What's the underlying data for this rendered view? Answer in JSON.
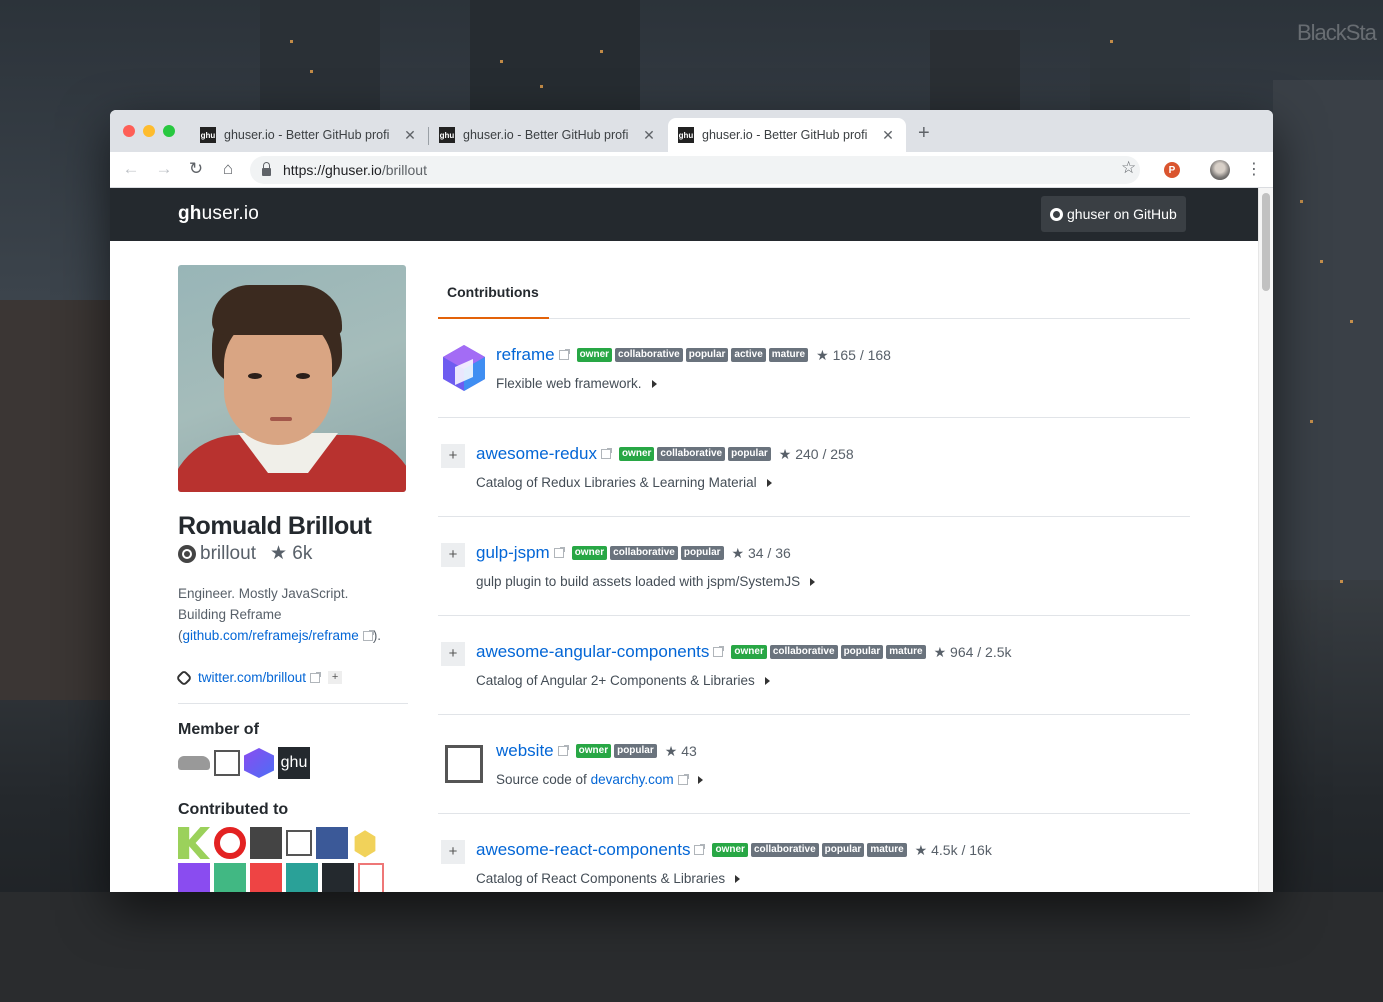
{
  "desktop": {
    "watermark": "BlackSta"
  },
  "browser": {
    "tabs": [
      {
        "favicon": "ghu",
        "title": "ghuser.io - Better GitHub profi",
        "close": "✕"
      },
      {
        "favicon": "ghu",
        "title": "ghuser.io - Better GitHub profi",
        "close": "✕"
      },
      {
        "favicon": "ghu",
        "title": "ghuser.io - Better GitHub profi",
        "close": "✕"
      }
    ],
    "new_tab": "+",
    "back": "←",
    "forward": "→",
    "reload": "↻",
    "home": "⌂",
    "url_host": "https://ghuser.io",
    "url_path": "/brillout",
    "bookmark_star": "☆",
    "extension": "P",
    "menu": "⋮"
  },
  "site": {
    "logo_bold": "gh",
    "logo_rest": "user.io",
    "github_button": "ghuser on GitHub"
  },
  "profile": {
    "name": "Romuald Brillout",
    "handle": "brillout",
    "stars": "★ 6k",
    "bio_line1": "Engineer. Mostly JavaScript.",
    "bio_line2": "Building Reframe",
    "bio_open": "(",
    "bio_link": "github.com/reframejs/reframe",
    "bio_close": ").",
    "twitter": "twitter.com/brillout",
    "twitter_plus": "+",
    "member_of_heading": "Member of",
    "member_ghu": "ghu",
    "contributed_heading": "Contributed to"
  },
  "main": {
    "tab_label": "Contributions",
    "repos": [
      {
        "name": "reframe",
        "badges": [
          "collaborative",
          "popular",
          "active",
          "mature"
        ],
        "owner": "owner",
        "stars": "★ 165 / 168",
        "desc": "Flexible web framework.",
        "desc_link": "",
        "plus": ""
      },
      {
        "name": "awesome-redux",
        "badges": [
          "collaborative",
          "popular"
        ],
        "owner": "owner",
        "stars": "★ 240 / 258",
        "desc": "Catalog of Redux Libraries & Learning Material",
        "desc_link": "",
        "plus": "+"
      },
      {
        "name": "gulp-jspm",
        "badges": [
          "collaborative",
          "popular"
        ],
        "owner": "owner",
        "stars": "★ 34 / 36",
        "desc": "gulp plugin to build assets loaded with jspm/SystemJS",
        "desc_link": "",
        "plus": "+"
      },
      {
        "name": "awesome-angular-components",
        "badges": [
          "collaborative",
          "popular",
          "mature"
        ],
        "owner": "owner",
        "stars": "★ 964 / 2.5k",
        "desc": "Catalog of Angular 2+ Components & Libraries",
        "desc_link": "",
        "plus": "+"
      },
      {
        "name": "website",
        "badges": [
          "popular"
        ],
        "owner": "owner",
        "stars": "★ 43",
        "desc": "Source code of ",
        "desc_link": "devarchy.com",
        "plus": ""
      },
      {
        "name": "awesome-react-components",
        "badges": [
          "collaborative",
          "popular",
          "mature"
        ],
        "owner": "owner",
        "stars": "★ 4.5k / 16k",
        "desc": "Catalog of React Components & Libraries",
        "desc_link": "",
        "plus": "+"
      }
    ]
  }
}
